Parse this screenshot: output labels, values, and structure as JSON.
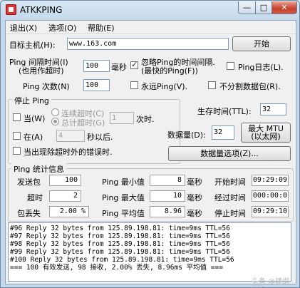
{
  "window": {
    "title": "ATKKPING",
    "min": "—",
    "max": "□",
    "close": "✕"
  },
  "menu": [
    "退出(X)",
    "选项(O)",
    "帮助(E)"
  ],
  "target": {
    "label": "目标主机(H):",
    "value": "www.163.com",
    "start_button": "开始"
  },
  "ping_interval": {
    "label_line1": "Ping 间隔时间(I)",
    "label_line2": "(也用作超时)",
    "value": "100",
    "unit": "毫秒"
  },
  "ignore_interval": {
    "label_line1": "忽略Ping的时间间隔.",
    "label_line2": "(最快的Ping(F))",
    "checked": true
  },
  "ping_log": {
    "label": "Ping日志(L).",
    "checked": false
  },
  "ping_count": {
    "label": "Ping 次数(N)",
    "value": "100"
  },
  "forever_ping": {
    "label": "永远Ping(V).",
    "checked": false
  },
  "no_split": {
    "label": "不分割数据包(R).",
    "checked": false
  },
  "stop_group": {
    "title": "停止 Ping",
    "when": {
      "label": "当(W)",
      "checked": false
    },
    "continuous_timeout": "连续超时(C)",
    "total_timeout": "总计超时(G)",
    "count_value": "1",
    "count_unit": "次时.",
    "at": {
      "label": "在(A)",
      "checked": false
    },
    "at_value": "4",
    "at_unit": "秒以后.",
    "on_error": {
      "label": "当出现除超时外的错误时.",
      "checked": false
    }
  },
  "ttl": {
    "label": "生存时间(TTL):",
    "value": "32"
  },
  "data_size": {
    "label": "数据量(D):",
    "value": "32",
    "max_button_line1": "最大 MTU",
    "max_button_line2": "(以太网)"
  },
  "data_options_button": "数据量选项(Z)...",
  "stats": {
    "title": "Ping  统计信息",
    "sent_label": "发送包",
    "sent": "100",
    "timeout_label": "超时",
    "timeout": "2",
    "loss_label": "包丢失",
    "loss": "2.00 %",
    "min_label": "Ping 最小值",
    "min": "8",
    "min_unit": "毫秒",
    "max_label": "Ping 最大值",
    "max": "10",
    "max_unit": "毫秒",
    "avg_label": "Ping 平均值",
    "avg": "8.96",
    "avg_unit": "毫秒",
    "start_label": "开始时间",
    "start": "09:29:09",
    "elapsed_label": "经过时间",
    "elapsed": "000:00:0",
    "stop_label": "停止时间",
    "stop": "09:29:10"
  },
  "log_lines": [
    "#96 Reply 32 bytes from 125.89.198.81: time=9ms TTL=56",
    "#97 Reply 32 bytes from 125.89.198.81: time=9ms TTL=56",
    "#98 Reply 32 bytes from 125.89.198.81: time=9ms TTL=56",
    "#99 Reply 32 bytes from 125.89.198.81: time=9ms TTL=56",
    "#100 Reply 32 bytes from 125.89.198.81: time=9ms TTL=56",
    "=== 100 有效发送,   98 接收,    2.00% 丢失, 8.96ms 平均值 ==="
  ],
  "watermark": "头条 @建纲666"
}
